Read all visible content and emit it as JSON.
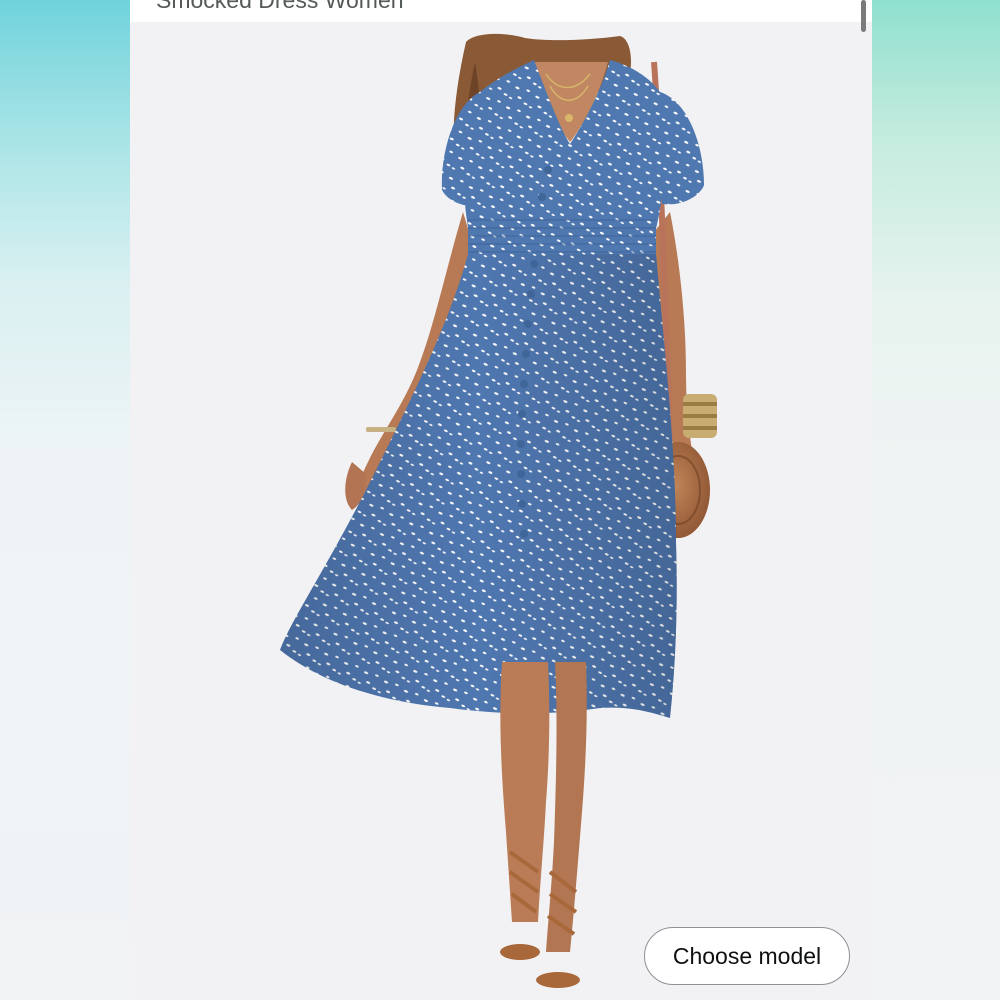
{
  "header": {
    "title": "Smocked Dress Women"
  },
  "product_image": {
    "description_icon": "model-wearing-dress-photo",
    "dress_color": "#4f77b0",
    "dot_color": "#ffffff"
  },
  "actions": {
    "choose_model_label": "Choose model"
  },
  "colors": {
    "button_border": "#8d9096",
    "button_text": "#0f1111",
    "title_text": "#565959"
  }
}
